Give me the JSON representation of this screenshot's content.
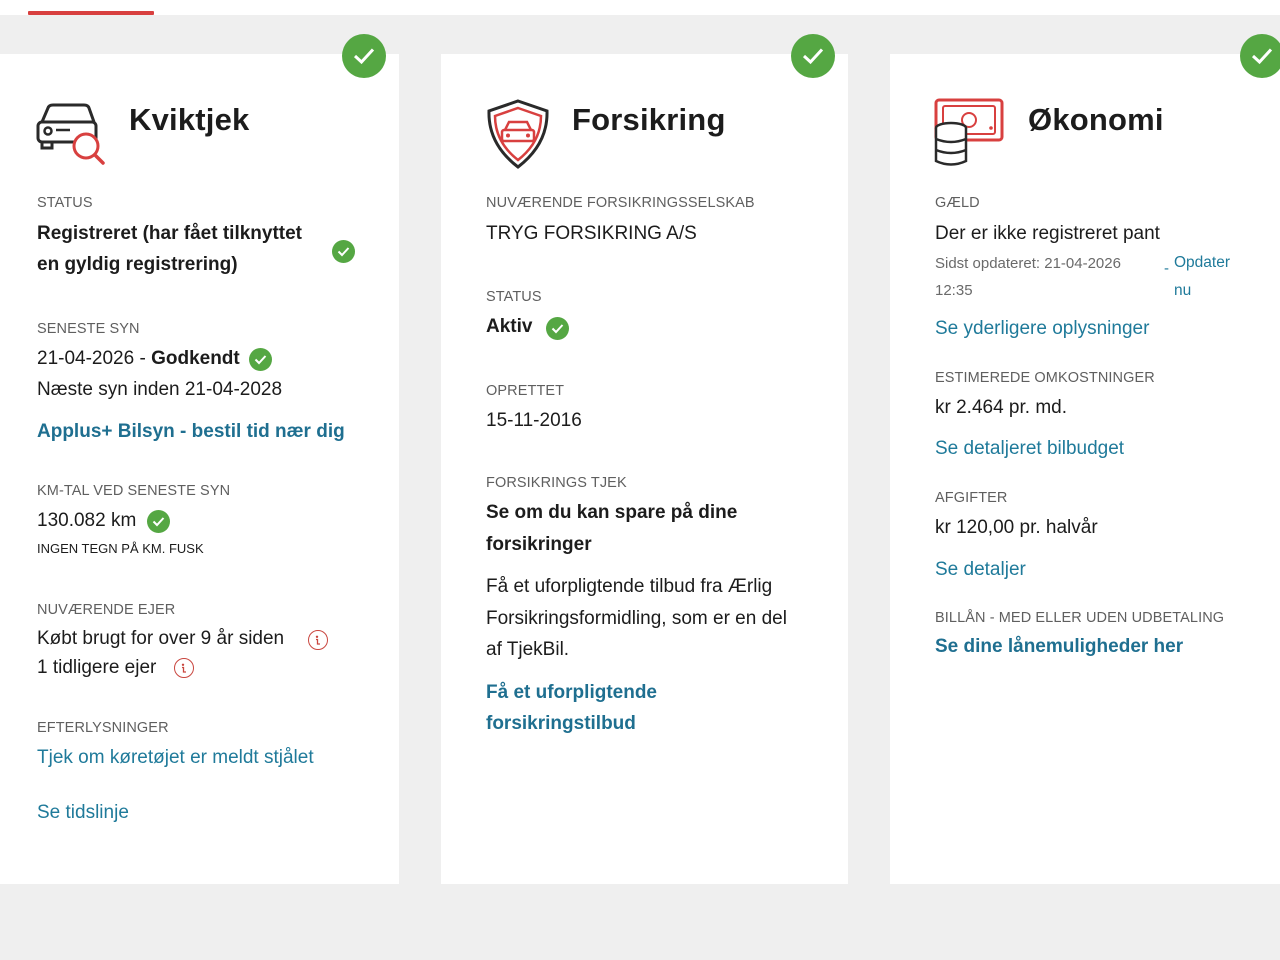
{
  "colors": {
    "accent_red": "#d8403f",
    "check_green": "#55a743",
    "link_blue": "#1f7a9a"
  },
  "kviktjek": {
    "title": "Kviktjek",
    "icon": "car-search-icon",
    "status_label": "STATUS",
    "status_line1": "Registreret (har fået tilknyttet",
    "status_line2": "en gyldig registrering)",
    "inspection_label": "SENESTE SYN",
    "inspection_date": "21-04-2026 - ",
    "inspection_result": "Godkendt",
    "next_inspection": "Næste syn inden 21-04-2028",
    "applus_link": "Applus+ Bilsyn - bestil tid nær dig",
    "km_label": "KM-TAL VED SENESTE SYN",
    "km_value": "130.082 km",
    "km_note": "INGEN TEGN PÅ KM. FUSK",
    "owner_label": "NUVÆRENDE EJER",
    "owner_bought": "Købt brugt for over 9 år siden",
    "owner_previous": "1 tidligere ejer",
    "wanted_label": "EFTERLYSNINGER",
    "wanted_link": "Tjek om køretøjet er meldt stjålet",
    "timeline_link": "Se tidslinje"
  },
  "forsikring": {
    "title": "Forsikring",
    "icon": "shield-car-icon",
    "company_label": "NUVÆRENDE FORSIKRINGSSELSKAB",
    "company_value": "TRYG FORSIKRING A/S",
    "status_label": "STATUS",
    "status_value": "Aktiv",
    "created_label": "OPRETTET",
    "created_value": "15-11-2016",
    "check_label": "FORSIKRINGS TJEK",
    "check_title_line1": "Se om du kan spare på dine",
    "check_title_line2": "forsikringer",
    "offer_line1": "Få et uforpligtende tilbud fra Ærlig",
    "offer_line2": "Forsikringsformidling, som er en del",
    "offer_line3": "af TjekBil.",
    "offer_link_line1": "Få et uforpligtende",
    "offer_link_line2": "forsikringstilbud"
  },
  "okonomi": {
    "title": "Økonomi",
    "icon": "money-coins-icon",
    "debt_label": "GÆLD",
    "debt_value": "Der er ikke registreret pant",
    "updated_line1": "Sidst opdateret: 21-04-2026",
    "updated_line2": "12:35",
    "update_dash": "-",
    "update_link_line1": "Opdater",
    "update_link_line2": "nu",
    "more_info_link": "Se yderligere oplysninger",
    "costs_label": "ESTIMEREDE OMKOSTNINGER",
    "costs_value": "kr 2.464 pr. md.",
    "budget_link": "Se detaljeret bilbudget",
    "fees_label": "AFGIFTER",
    "fees_value": "kr 120,00 pr. halvår",
    "fees_link": "Se detaljer",
    "loan_label": "BILLÅN - MED ELLER UDEN UDBETALING",
    "loan_link": "Se dine lånemuligheder her"
  }
}
